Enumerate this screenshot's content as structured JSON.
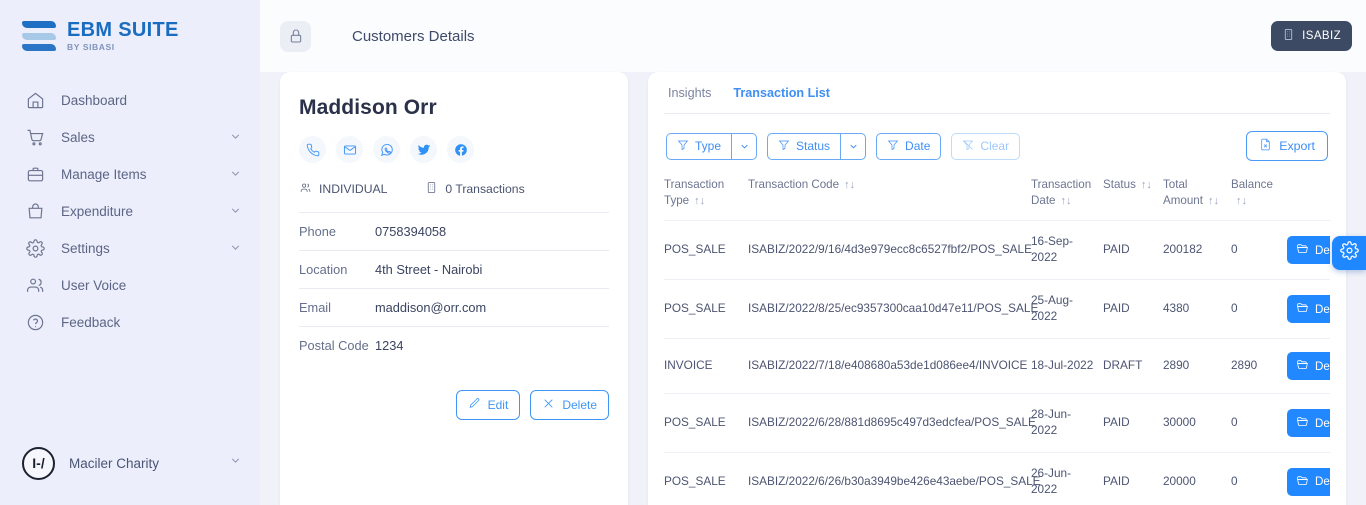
{
  "brand": {
    "title": "EBM SUITE",
    "subtitle": "BY SIBASI",
    "logo_icon": "stacked-waves-logo"
  },
  "sidebar": {
    "items": [
      {
        "label": "Dashboard",
        "icon": "home-icon",
        "expandable": false
      },
      {
        "label": "Sales",
        "icon": "cart-icon",
        "expandable": true
      },
      {
        "label": "Manage Items",
        "icon": "briefcase-icon",
        "expandable": true
      },
      {
        "label": "Expenditure",
        "icon": "bag-icon",
        "expandable": true
      },
      {
        "label": "Settings",
        "icon": "gear-icon",
        "expandable": true
      },
      {
        "label": "User Voice",
        "icon": "people-icon",
        "expandable": false
      },
      {
        "label": "Feedback",
        "icon": "question-circle-icon",
        "expandable": false
      }
    ],
    "user": {
      "name": "Maciler Charity",
      "avatar_initials": "I-/",
      "chevron": "chevron-down-icon"
    }
  },
  "topbar": {
    "lock_icon": "lock-icon",
    "title": "Customers Details",
    "org_badge": {
      "label": "ISABIZ",
      "icon": "building-icon"
    }
  },
  "customer": {
    "name": "Maddison Orr",
    "socials": [
      {
        "name": "phone-icon"
      },
      {
        "name": "email-icon"
      },
      {
        "name": "whatsapp-icon"
      },
      {
        "name": "twitter-icon"
      },
      {
        "name": "facebook-icon"
      }
    ],
    "type_label": "INDIVIDUAL",
    "type_icon": "people-icon",
    "transactions_label": "0 Transactions",
    "transactions_icon": "building-icon",
    "fields": [
      {
        "label": "Phone",
        "value": "0758394058"
      },
      {
        "label": "Location",
        "value": "4th Street - Nairobi"
      },
      {
        "label": "Email",
        "value": "maddison@orr.com"
      },
      {
        "label": "Postal Code",
        "value": "1234"
      }
    ],
    "edit_label": "Edit",
    "edit_icon": "pencil-icon",
    "delete_label": "Delete",
    "delete_icon": "close-x-icon"
  },
  "transactions_panel": {
    "tabs": [
      {
        "label": "Insights",
        "active": false
      },
      {
        "label": "Transaction List",
        "active": true
      }
    ],
    "filters": [
      {
        "label": "Type",
        "icon": "filter-icon",
        "has_caret": true,
        "disabled": false
      },
      {
        "label": "Status",
        "icon": "filter-icon",
        "has_caret": true,
        "disabled": false
      },
      {
        "label": "Date",
        "icon": "filter-icon",
        "has_caret": false,
        "disabled": false
      },
      {
        "label": "Clear",
        "icon": "filter-off-icon",
        "has_caret": false,
        "disabled": true
      }
    ],
    "export": {
      "label": "Export",
      "icon": "file-export-icon"
    },
    "columns": [
      {
        "label": "Transaction Type",
        "sortable": true
      },
      {
        "label": "Transaction Code",
        "sortable": true
      },
      {
        "label": "Transaction Date",
        "sortable": true
      },
      {
        "label": "Status",
        "sortable": true
      },
      {
        "label": "Total Amount",
        "sortable": true
      },
      {
        "label": "Balance",
        "sortable": true
      },
      {
        "label": "",
        "sortable": false
      }
    ],
    "sort_glyph": "↑↓",
    "row_action": {
      "label": "Details",
      "icon": "folder-icon",
      "caret": "chevron-down-icon"
    },
    "rows": [
      {
        "type": "POS_SALE",
        "code": "ISABIZ/2022/9/16/4d3e979ecc8c6527fbf2/POS_SALE",
        "date": "16-Sep-2022",
        "status": "PAID",
        "total_amount": "200182",
        "balance": "0"
      },
      {
        "type": "POS_SALE",
        "code": "ISABIZ/2022/8/25/ec9357300caa10d47e11/POS_SALE",
        "date": "25-Aug-2022",
        "status": "PAID",
        "total_amount": "4380",
        "balance": "0"
      },
      {
        "type": "INVOICE",
        "code": "ISABIZ/2022/7/18/e408680a53de1d086ee4/INVOICE",
        "date": "18-Jul-2022",
        "status": "DRAFT",
        "total_amount": "2890",
        "balance": "2890"
      },
      {
        "type": "POS_SALE",
        "code": "ISABIZ/2022/6/28/881d8695c497d3edcfea/POS_SALE",
        "date": "28-Jun-2022",
        "status": "PAID",
        "total_amount": "30000",
        "balance": "0"
      },
      {
        "type": "POS_SALE",
        "code": "ISABIZ/2022/6/26/b30a3949be426e43aebe/POS_SALE",
        "date": "26-Jun-2022",
        "status": "PAID",
        "total_amount": "20000",
        "balance": "0"
      }
    ]
  },
  "settings_fab": {
    "icon": "gear-icon"
  },
  "colors": {
    "accent": "#2288ff",
    "brand_blue": "#1a6cc0",
    "sidebar_bg": "#eceefb",
    "page_bg": "#f1f2f9",
    "org_badge_bg": "#3d4a63"
  }
}
